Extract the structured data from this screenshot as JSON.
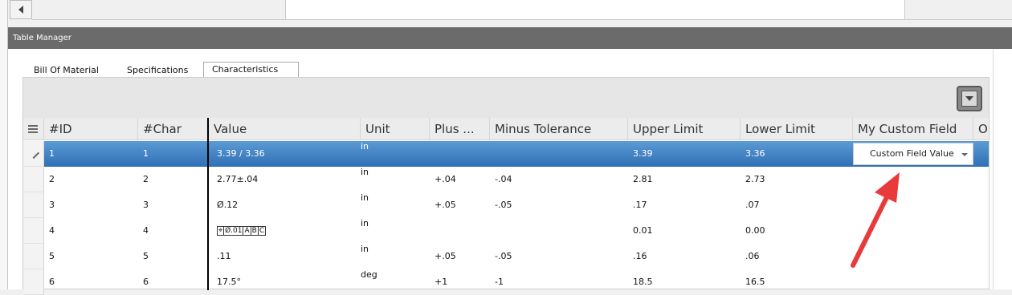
{
  "panel": {
    "title": "Table Manager"
  },
  "tabs": [
    {
      "label": "Bill Of Material"
    },
    {
      "label": "Specifications"
    },
    {
      "label": "Characteristics"
    }
  ],
  "columns": [
    "#ID",
    "#Char",
    "Value",
    "Unit",
    "Plus ...",
    "Minus Tolerance",
    "Upper Limit",
    "Lower Limit",
    "My Custom Field",
    "Op"
  ],
  "rows": [
    {
      "id": "1",
      "char": "1",
      "value": "3.39 / 3.36",
      "unit": "in",
      "plus": "",
      "minus": "",
      "upper": "3.39",
      "lower": "3.36"
    },
    {
      "id": "2",
      "char": "2",
      "value": "2.77±.04",
      "unit": "in",
      "plus": "+.04",
      "minus": "-.04",
      "upper": "2.81",
      "lower": "2.73"
    },
    {
      "id": "3",
      "char": "3",
      "value": "Ø.12",
      "unit": "in",
      "plus": "+.05",
      "minus": "-.05",
      "upper": ".17",
      "lower": ".07"
    },
    {
      "id": "4",
      "char": "4",
      "value": "",
      "unit": "in",
      "plus": "",
      "minus": "",
      "upper": "0.01",
      "lower": "0.00"
    },
    {
      "id": "5",
      "char": "5",
      "value": ".11",
      "unit": "in",
      "plus": "+.05",
      "minus": "-.05",
      "upper": ".16",
      "lower": ".06"
    },
    {
      "id": "6",
      "char": "6",
      "value": "17.5°",
      "unit": "deg",
      "plus": "+1",
      "minus": "-1",
      "upper": "18.5",
      "lower": "16.5"
    }
  ],
  "gdt_frame": [
    "⌖",
    "Ø.01",
    "A",
    "B",
    "C"
  ],
  "custom_field": {
    "value": "Custom Field Value"
  },
  "colors": {
    "selected_row": "#3a7cc1",
    "panel_title_bg": "#6b6b6b",
    "arrow": "#e8393b"
  }
}
